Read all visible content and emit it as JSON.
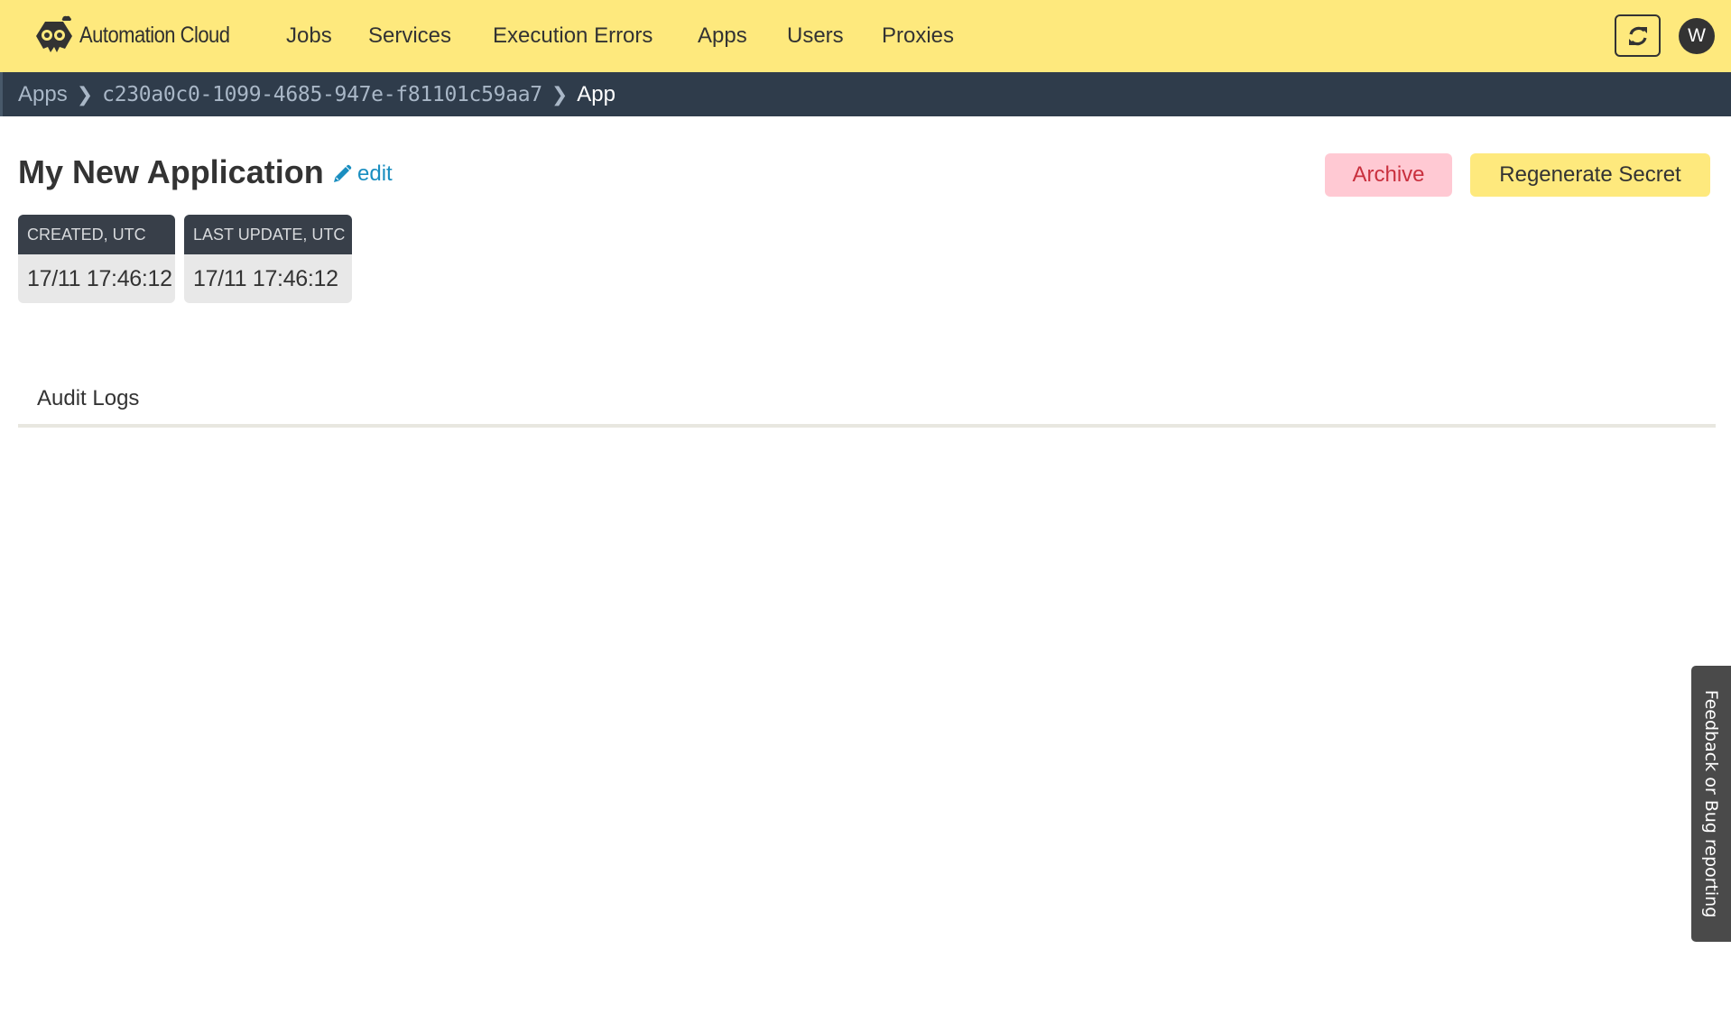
{
  "app": {
    "brand": "Automation Cloud",
    "colors": {
      "header_bg": "#fee97d",
      "breadcrumb_bg": "#2f3c4b",
      "link": "#1a8ec0",
      "danger_bg": "#ffc9d3",
      "danger_text": "#c9303e"
    }
  },
  "nav": {
    "items": [
      {
        "label": "Jobs"
      },
      {
        "label": "Services"
      },
      {
        "label": "Execution Errors"
      },
      {
        "label": "Apps"
      },
      {
        "label": "Users"
      },
      {
        "label": "Proxies"
      }
    ],
    "refresh_icon": "refresh-icon",
    "avatar_initial": "W"
  },
  "breadcrumb": {
    "items": [
      {
        "label": "Apps"
      },
      {
        "label": "c230a0c0-1099-4685-947e-f81101c59aa7"
      },
      {
        "label": "App"
      }
    ],
    "separator": "❯"
  },
  "page": {
    "title": "My New Application",
    "edit_label": "edit",
    "actions": {
      "archive_label": "Archive",
      "regenerate_label": "Regenerate Secret"
    },
    "timestamps": [
      {
        "label": "CREATED, UTC",
        "value": "17/11 17:46:12"
      },
      {
        "label": "LAST UPDATE, UTC",
        "value": "17/11 17:46:12"
      }
    ],
    "tabs": [
      {
        "label": "Audit Logs"
      }
    ]
  },
  "feedback": {
    "label": "Feedback or Bug reporting"
  }
}
